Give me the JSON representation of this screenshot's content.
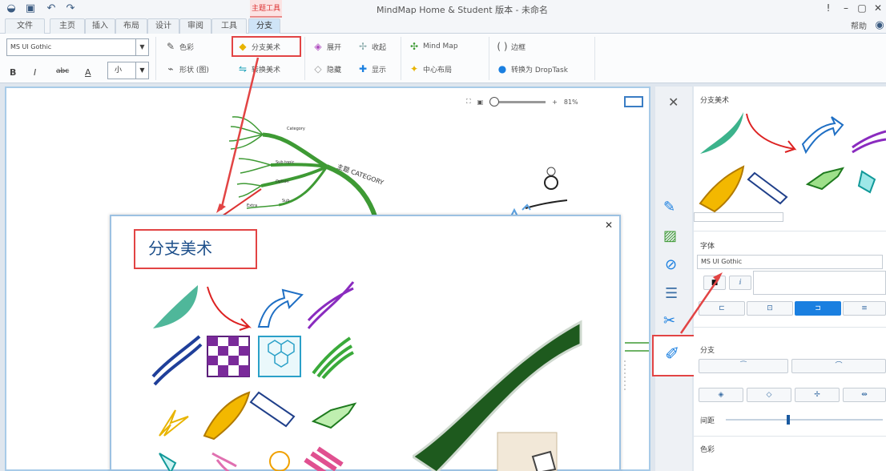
{
  "window": {
    "title": "MindMap Home & Student 版本 - 未命名",
    "context_tab_label": "主题工具",
    "help_label": "帮助"
  },
  "quick_access": [
    "app-logo-icon",
    "save-icon",
    "undo-icon",
    "redo-icon"
  ],
  "tabs": [
    {
      "label": "文件",
      "active": false
    },
    {
      "label": "主页",
      "active": false
    },
    {
      "label": "插入",
      "active": false
    },
    {
      "label": "布局",
      "active": false
    },
    {
      "label": "设计",
      "active": false
    },
    {
      "label": "审阅",
      "active": false
    },
    {
      "label": "工具",
      "active": false
    },
    {
      "label": "分支",
      "active": true
    }
  ],
  "ribbon": {
    "font_name": "MS UI Gothic",
    "font_size": "小",
    "format_buttons": [
      "B",
      "I",
      "abc",
      "A"
    ],
    "buttons": {
      "color": "色彩",
      "branch_art": "分支美术",
      "shape": "形状 (图)",
      "convert_art": "转换美术",
      "expand": "展开",
      "collapse": "收起",
      "hide": "隐藏",
      "show": "显示",
      "mind_map": "Mind Map",
      "center_layout": "中心布局",
      "boundary": "边框",
      "dropbox": "转换为 DropTask"
    }
  },
  "canvas": {
    "zoom_label": "81%",
    "central_topic": "主题 CATEGORY",
    "branch_labels": [
      "Category",
      "Sub topic",
      "Sub topic",
      "Option",
      "Sub",
      "Extra"
    ]
  },
  "panel": {
    "branch_art_header": "分支美术",
    "font_header": "字体",
    "font_value": "MS UI Gothic",
    "branch_header": "分支",
    "spacing_label": "间距",
    "color_header": "色彩"
  },
  "popup": {
    "title": "分支美术"
  },
  "colors": {
    "accent": "#1a7fe0",
    "highlight_red": "#e24444",
    "mindmap_green": "#3e9a34"
  }
}
